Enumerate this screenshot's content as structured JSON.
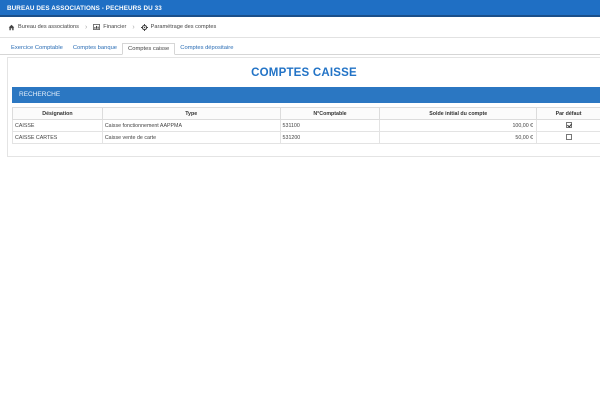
{
  "header": {
    "title": "BUREAU DES ASSOCIATIONS - PECHEURS DU 33"
  },
  "breadcrumb": {
    "items": [
      {
        "label": "Bureau des associations",
        "icon": "home-icon"
      },
      {
        "label": "Financier",
        "icon": "chart-icon"
      },
      {
        "label": "Paramétrage des comptes",
        "icon": "gear-icon"
      }
    ]
  },
  "tabs": [
    {
      "label": "Exercice Comptable",
      "active": false
    },
    {
      "label": "Comptes banque",
      "active": false
    },
    {
      "label": "Comptes caisse",
      "active": true
    },
    {
      "label": "Comptes dépositaire",
      "active": false
    }
  ],
  "main": {
    "title": "COMPTES CAISSE",
    "search_label": "RECHERCHE"
  },
  "table": {
    "columns": [
      "Désignation",
      "Type",
      "N°Comptable",
      "Solde initial du compte",
      "Par défaut"
    ],
    "rows": [
      {
        "designation": "CAISSE",
        "type": "Caisse fonctionnement AAPPMA",
        "numero": "531100",
        "solde": "100,00 €",
        "par_defaut": true
      },
      {
        "designation": "CAISSE CARTES",
        "type": "Caisse vente de carte",
        "numero": "531200",
        "solde": "50,00 €",
        "par_defaut": false
      }
    ]
  },
  "colors": {
    "topbar": "#1f6fc4",
    "title": "#2273c6",
    "search_bar": "#2b77c2",
    "tab_link": "#2a6db5"
  }
}
